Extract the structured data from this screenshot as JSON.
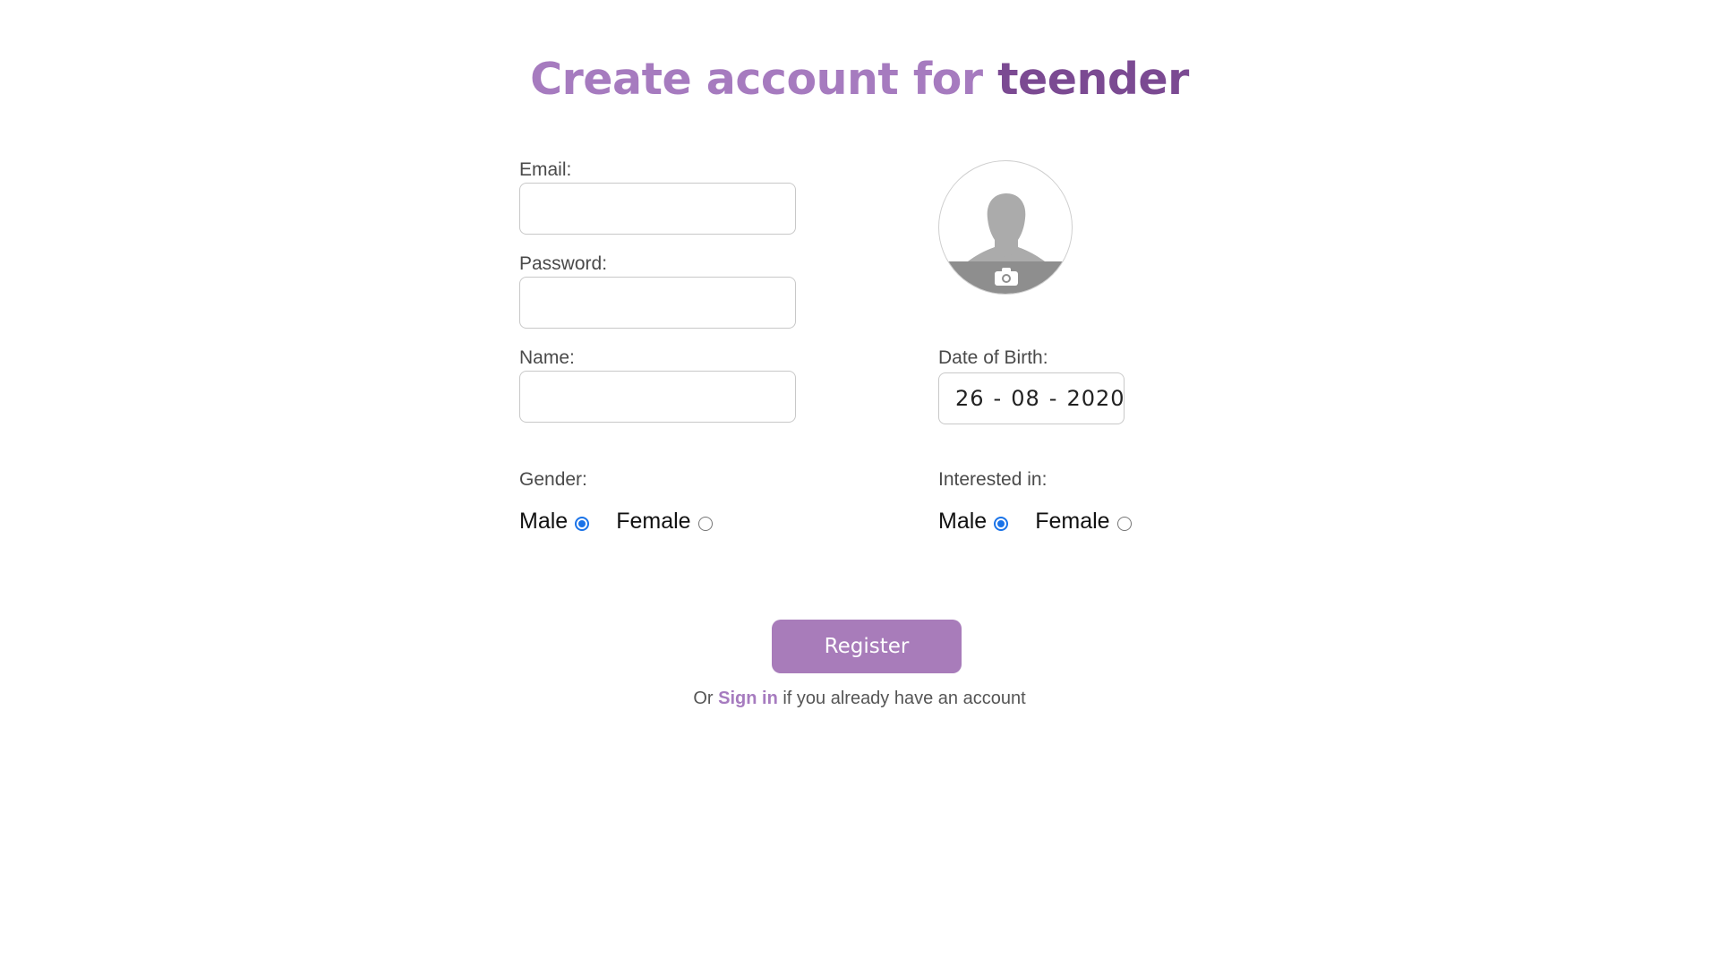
{
  "header": {
    "title_prefix": "Create account for ",
    "brand": "teender"
  },
  "form": {
    "email_label": "Email:",
    "email_value": "",
    "password_label": "Password:",
    "password_value": "",
    "name_label": "Name:",
    "name_value": "",
    "dob_label": "Date of Birth:",
    "dob_day": "26",
    "dob_month": "08",
    "dob_year": "2020",
    "dob_sep": "-",
    "gender_label": "Gender:",
    "gender_options": [
      {
        "label": "Male",
        "checked": true
      },
      {
        "label": "Female",
        "checked": false
      }
    ],
    "interested_label": "Interested in:",
    "interested_options": [
      {
        "label": "Male",
        "checked": true
      },
      {
        "label": "Female",
        "checked": false
      }
    ],
    "avatar_icon": "user-silhouette-icon",
    "camera_icon": "camera-icon"
  },
  "actions": {
    "register_label": "Register",
    "signin_prefix": "Or ",
    "signin_link": "Sign in",
    "signin_suffix": " if you already have an account"
  },
  "colors": {
    "accent": "#a67bbf",
    "brand": "#7b4a92",
    "button": "#a87cba",
    "radio_checked": "#1a73e8"
  }
}
